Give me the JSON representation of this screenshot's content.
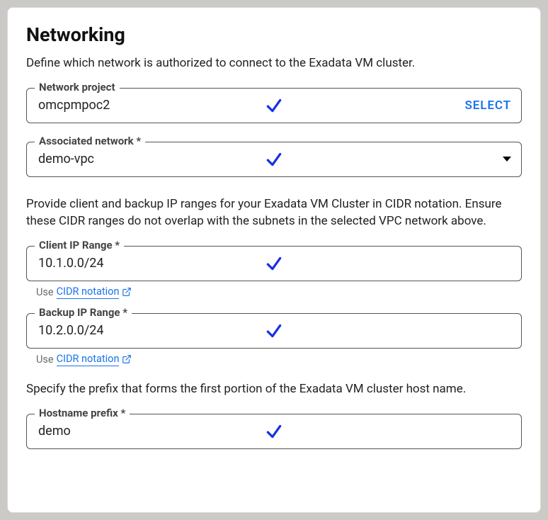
{
  "section": {
    "title": "Networking",
    "intro": "Define which network is authorized to connect to the Exadata VM cluster.",
    "ip_ranges_intro": "Provide client and backup IP ranges for your Exadata VM Cluster in CIDR notation. Ensure these CIDR ranges do not overlap with the subnets in the selected VPC network above.",
    "hostname_intro": "Specify the prefix that forms the first portion of the Exadata VM cluster host name."
  },
  "fields": {
    "network_project": {
      "label": "Network project",
      "value": "omcpmpoc2",
      "action": "SELECT"
    },
    "associated_network": {
      "label": "Associated network *",
      "value": "demo-vpc"
    },
    "client_ip": {
      "label": "Client IP Range *",
      "value": "10.1.0.0/24",
      "hint_prefix": "Use ",
      "hint_link": "CIDR notation"
    },
    "backup_ip": {
      "label": "Backup IP Range *",
      "value": "10.2.0.0/24",
      "hint_prefix": "Use ",
      "hint_link": "CIDR notation"
    },
    "hostname_prefix": {
      "label": "Hostname prefix *",
      "value": "demo"
    }
  }
}
